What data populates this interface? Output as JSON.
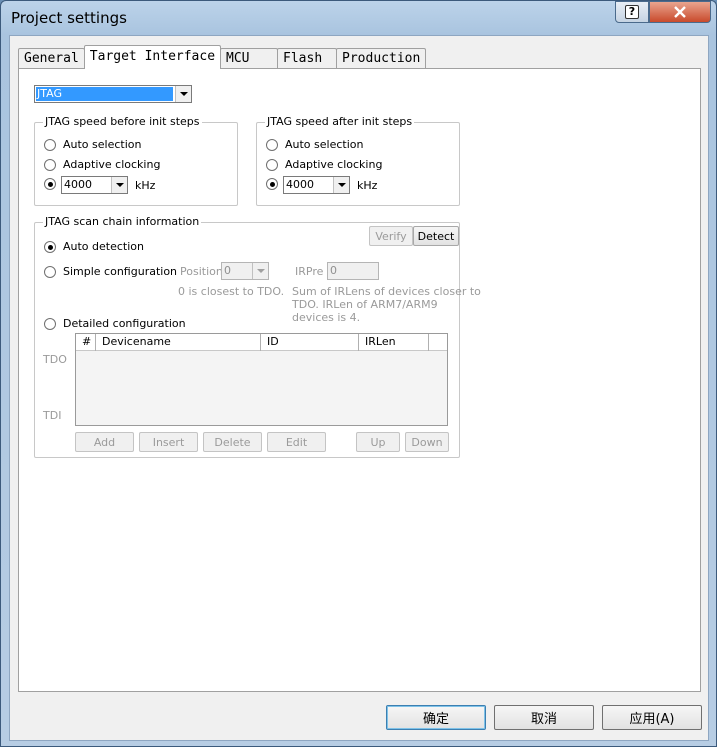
{
  "window": {
    "title": "Project settings"
  },
  "tabs": [
    {
      "label": "General"
    },
    {
      "label": "Target Interface"
    },
    {
      "label": "MCU"
    },
    {
      "label": "Flash"
    },
    {
      "label": "Production"
    }
  ],
  "interface_select": {
    "value": "JTAG"
  },
  "speed_before": {
    "title": "JTAG speed before init steps",
    "auto_selection": "Auto selection",
    "adaptive_clocking": "Adaptive clocking",
    "speed_value": "4000",
    "unit": "kHz",
    "selected": "fixed"
  },
  "speed_after": {
    "title": "JTAG speed after init steps",
    "auto_selection": "Auto selection",
    "adaptive_clocking": "Adaptive clocking",
    "speed_value": "4000",
    "unit": "kHz",
    "selected": "fixed"
  },
  "scan_chain": {
    "title": "JTAG scan chain information",
    "verify_label": "Verify",
    "detect_label": "Detect",
    "auto_detection": "Auto detection",
    "simple_configuration": "Simple configuration",
    "position_label": "Position",
    "position_value": "0",
    "position_hint": "0 is closest to TDO.",
    "irpre_label": "IRPre",
    "irpre_value": "0",
    "irpre_hint_1": "Sum of IRLens of devices closer to",
    "irpre_hint_2": "TDO. IRLen of ARM7/ARM9",
    "irpre_hint_3": "devices is 4.",
    "detailed_configuration": "Detailed configuration",
    "tdo_label": "TDO",
    "tdi_label": "TDI",
    "columns": [
      "#",
      "Devicename",
      "ID",
      "IRLen"
    ],
    "buttons": {
      "add": "Add",
      "insert": "Insert",
      "delete": "Delete",
      "edit": "Edit",
      "up": "Up",
      "down": "Down"
    },
    "selected": "auto"
  },
  "footer": {
    "ok": "确定",
    "cancel": "取消",
    "apply": "应用(A)"
  },
  "colors": {
    "titlebar": "#a9c4df",
    "selection": "#3399ff",
    "close_button": "#c94a2c"
  }
}
